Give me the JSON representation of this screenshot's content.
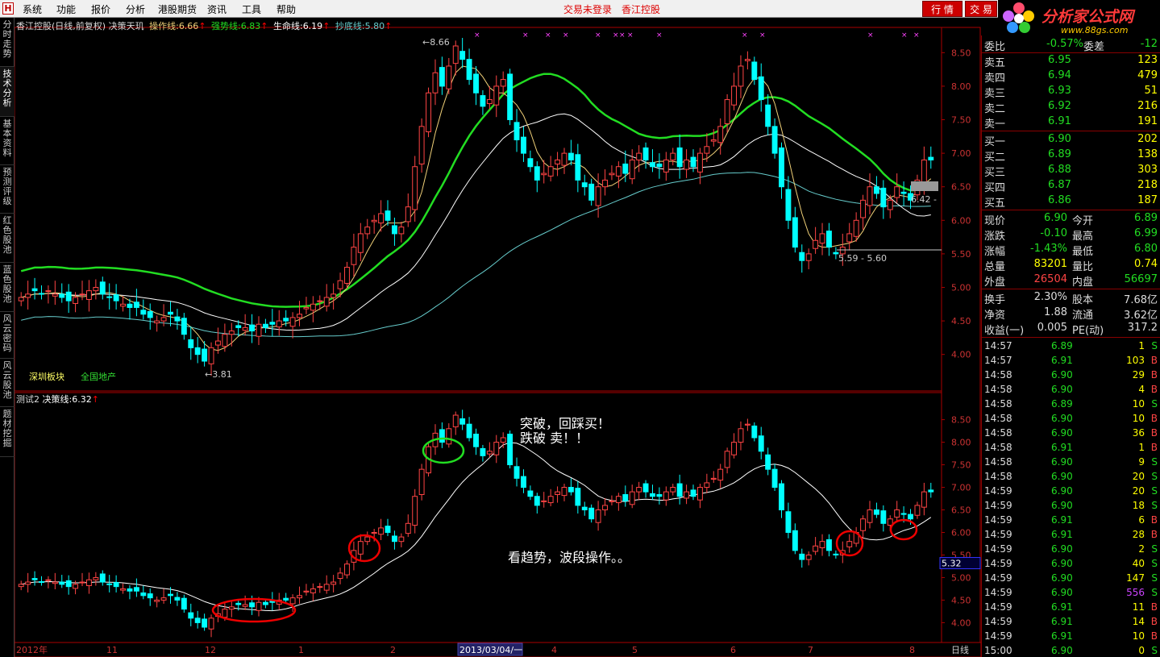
{
  "app": {
    "menu": [
      "系统",
      "功能",
      "报价",
      "分析",
      "港股期货",
      "资讯",
      "工具",
      "帮助"
    ],
    "status_login": "交易未登录",
    "status_stock": "香江控股",
    "btn_quote": "行 情",
    "btn_trade": "交 易"
  },
  "brand": {
    "name": "分析家公式网",
    "url": "www.88gs.com"
  },
  "left_tabs": [
    {
      "label": "分时走势"
    },
    {
      "label": "技术分析"
    },
    {
      "label": "基本资料"
    },
    {
      "label": "预测评级"
    },
    {
      "label": "红色股池"
    },
    {
      "label": "蓝色股池"
    },
    {
      "label": "风云密码"
    },
    {
      "label": "风云股池"
    },
    {
      "label": "题材挖掘"
    }
  ],
  "chart_top": {
    "title": "香江控股(日线,前复权)",
    "formula": "决策天玑",
    "indicators": [
      {
        "label": "操作线:",
        "value": "6.66",
        "color": "#f0d078"
      },
      {
        "label": "强势线:",
        "value": "6.83",
        "color": "#22dd22"
      },
      {
        "label": "生命线:",
        "value": "6.19",
        "color": "#ffffff"
      },
      {
        "label": "抄底线:",
        "value": "5.80",
        "color": "#66cccc"
      }
    ],
    "y_ticks": [
      "8.50",
      "8.00",
      "7.50",
      "7.00",
      "6.50",
      "6.00",
      "5.50",
      "5.00",
      "4.50",
      "4.00"
    ],
    "price_labels": {
      "high": "8.66",
      "low": "3.81",
      "right": "6.42",
      "range": "5.59 - 5.60"
    },
    "sector1": "深圳板块",
    "sector2": "全国地产"
  },
  "chart_bottom": {
    "title": "测试2",
    "indicator_label": "决策线:",
    "indicator_value": "6.32",
    "y_ticks": [
      "8.50",
      "8.00",
      "7.50",
      "7.00",
      "6.50",
      "6.00",
      "5.50",
      "5.00",
      "4.50",
      "4.00"
    ],
    "current_price": "5.32",
    "annot1": "突破，回踩买！",
    "annot2": "跌破 卖！！",
    "annot3": "看趋势，波段操作。。"
  },
  "x_axis": {
    "labels": [
      "2012年",
      "11",
      "12",
      "1",
      "2",
      "2013/03/04/一",
      "4",
      "5",
      "6",
      "7",
      "8"
    ],
    "period": "日线"
  },
  "chart_data": {
    "type": "candlestick",
    "symbol": "香江控股",
    "period": "daily",
    "ylim": [
      3.8,
      8.7
    ],
    "marked_high": 8.66,
    "marked_low": 3.81,
    "months": [
      "2012-10",
      "2012-11",
      "2012-12",
      "2013-01",
      "2013-02",
      "2013-03",
      "2013-04",
      "2013-05",
      "2013-06",
      "2013-07",
      "2013-08"
    ],
    "approx_closes": [
      4.85,
      4.9,
      4.95,
      4.9,
      4.95,
      4.9,
      4.85,
      4.8,
      4.85,
      4.9,
      4.95,
      5.0,
      4.9,
      4.85,
      4.8,
      4.75,
      4.7,
      4.7,
      4.6,
      4.55,
      4.5,
      4.55,
      4.6,
      4.5,
      4.3,
      4.1,
      4.0,
      3.9,
      4.1,
      4.2,
      4.3,
      4.35,
      4.4,
      4.4,
      4.35,
      4.45,
      4.4,
      4.45,
      4.5,
      4.5,
      4.55,
      4.6,
      4.7,
      4.75,
      4.8,
      4.85,
      4.9,
      5.1,
      5.3,
      5.6,
      5.8,
      5.9,
      6.0,
      6.1,
      6.0,
      5.8,
      5.9,
      6.2,
      6.8,
      7.4,
      7.9,
      8.2,
      8.0,
      8.3,
      8.6,
      8.4,
      8.1,
      7.9,
      7.7,
      7.8,
      8.0,
      8.1,
      7.5,
      7.2,
      7.0,
      6.8,
      6.6,
      6.7,
      6.8,
      6.9,
      7.0,
      6.9,
      6.6,
      6.5,
      6.3,
      6.5,
      6.6,
      6.7,
      6.8,
      6.7,
      6.9,
      7.0,
      6.9,
      6.8,
      6.8,
      6.9,
      7.0,
      6.8,
      6.9,
      6.8,
      7.0,
      7.1,
      7.2,
      7.4,
      7.8,
      8.0,
      8.3,
      8.4,
      8.1,
      7.8,
      7.4,
      7.0,
      6.5,
      6.0,
      5.6,
      5.4,
      5.5,
      5.7,
      5.8,
      5.6,
      5.5,
      5.6,
      5.8,
      6.0,
      6.3,
      6.5,
      6.4,
      6.2,
      6.3,
      6.5,
      6.4,
      6.3,
      6.6,
      6.9,
      6.9
    ],
    "series": [
      {
        "name": "操作线",
        "value": 6.66,
        "color": "#f0d078"
      },
      {
        "name": "强势线",
        "value": 6.83,
        "color": "#22dd22"
      },
      {
        "name": "生命线",
        "value": 6.19,
        "color": "#ffffff"
      },
      {
        "name": "抄底线",
        "value": 5.8,
        "color": "#66cccc"
      },
      {
        "name": "决策线",
        "value": 6.32,
        "color": "#ffffff"
      }
    ]
  },
  "quote": {
    "wei_bi": {
      "label": "委比",
      "value": "-0.57%",
      "label2": "委差",
      "value2": "-12"
    },
    "asks": [
      {
        "label": "卖五",
        "price": "6.95",
        "vol": "123"
      },
      {
        "label": "卖四",
        "price": "6.94",
        "vol": "479"
      },
      {
        "label": "卖三",
        "price": "6.93",
        "vol": "51"
      },
      {
        "label": "卖二",
        "price": "6.92",
        "vol": "216"
      },
      {
        "label": "卖一",
        "price": "6.91",
        "vol": "191"
      }
    ],
    "bids": [
      {
        "label": "买一",
        "price": "6.90",
        "vol": "202"
      },
      {
        "label": "买二",
        "price": "6.89",
        "vol": "138"
      },
      {
        "label": "买三",
        "price": "6.88",
        "vol": "303"
      },
      {
        "label": "买四",
        "price": "6.87",
        "vol": "218"
      },
      {
        "label": "买五",
        "price": "6.86",
        "vol": "187"
      }
    ],
    "stats": [
      {
        "l1": "现价",
        "v1": "6.90",
        "c1": "#22dd22",
        "l2": "今开",
        "v2": "6.89",
        "c2": "#22dd22"
      },
      {
        "l1": "涨跌",
        "v1": "-0.10",
        "c1": "#22dd22",
        "l2": "最高",
        "v2": "6.99",
        "c2": "#22dd22"
      },
      {
        "l1": "涨幅",
        "v1": "-1.43%",
        "c1": "#22dd22",
        "l2": "最低",
        "v2": "6.80",
        "c2": "#22dd22"
      },
      {
        "l1": "总量",
        "v1": "83201",
        "c1": "#ffff00",
        "l2": "量比",
        "v2": "0.74",
        "c2": "#ffff00"
      },
      {
        "l1": "外盘",
        "v1": "26504",
        "c1": "#ff4444",
        "l2": "内盘",
        "v2": "56697",
        "c2": "#22dd22"
      }
    ],
    "stats2": [
      {
        "l1": "换手",
        "v1": "2.30%",
        "l2": "股本",
        "v2": "7.68亿"
      },
      {
        "l1": "净资",
        "v1": "1.88",
        "l2": "流通",
        "v2": "3.62亿"
      },
      {
        "l1": "收益(一)",
        "v1": "0.005",
        "l2": "PE(动)",
        "v2": "317.2"
      }
    ]
  },
  "ticks": [
    {
      "t": "14:57",
      "p": "6.89",
      "v": "1",
      "s": "S"
    },
    {
      "t": "14:57",
      "p": "6.91",
      "v": "103",
      "s": "B"
    },
    {
      "t": "14:58",
      "p": "6.90",
      "v": "29",
      "s": "B"
    },
    {
      "t": "14:58",
      "p": "6.90",
      "v": "4",
      "s": "B"
    },
    {
      "t": "14:58",
      "p": "6.89",
      "v": "10",
      "s": "S"
    },
    {
      "t": "14:58",
      "p": "6.90",
      "v": "10",
      "s": "B"
    },
    {
      "t": "14:58",
      "p": "6.90",
      "v": "36",
      "s": "B"
    },
    {
      "t": "14:58",
      "p": "6.91",
      "v": "1",
      "s": "B"
    },
    {
      "t": "14:58",
      "p": "6.90",
      "v": "9",
      "s": "S"
    },
    {
      "t": "14:58",
      "p": "6.90",
      "v": "20",
      "s": "S"
    },
    {
      "t": "14:59",
      "p": "6.90",
      "v": "20",
      "s": "S"
    },
    {
      "t": "14:59",
      "p": "6.90",
      "v": "18",
      "s": "S"
    },
    {
      "t": "14:59",
      "p": "6.91",
      "v": "6",
      "s": "B"
    },
    {
      "t": "14:59",
      "p": "6.91",
      "v": "28",
      "s": "B"
    },
    {
      "t": "14:59",
      "p": "6.90",
      "v": "2",
      "s": "S"
    },
    {
      "t": "14:59",
      "p": "6.90",
      "v": "40",
      "s": "S"
    },
    {
      "t": "14:59",
      "p": "6.90",
      "v": "147",
      "s": "S"
    },
    {
      "t": "14:59",
      "p": "6.90",
      "v": "556",
      "s": "S"
    },
    {
      "t": "14:59",
      "p": "6.91",
      "v": "11",
      "s": "B"
    },
    {
      "t": "14:59",
      "p": "6.91",
      "v": "14",
      "s": "B"
    },
    {
      "t": "14:59",
      "p": "6.91",
      "v": "10",
      "s": "B"
    },
    {
      "t": "15:00",
      "p": "6.90",
      "v": "0",
      "s": "S"
    }
  ]
}
